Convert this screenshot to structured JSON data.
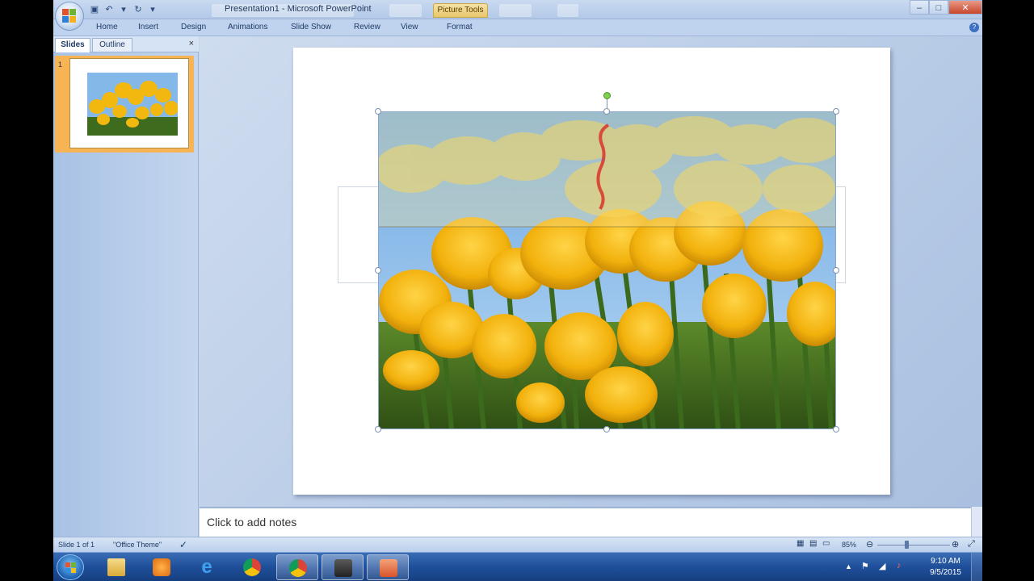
{
  "window": {
    "title": "Presentation1 - Microsoft PowerPoint",
    "contextual_tab_group": "Picture Tools"
  },
  "ribbon": {
    "tabs": [
      "Home",
      "Insert",
      "Design",
      "Animations",
      "Slide Show",
      "Review",
      "View",
      "Format"
    ]
  },
  "left_pane": {
    "tab_slides": "Slides",
    "tab_outline": "Outline",
    "close": "×",
    "slide_number": "1"
  },
  "notes": {
    "placeholder": "Click to add notes"
  },
  "status_bar": {
    "slide_info": "Slide 1 of 1",
    "theme": "\"Office Theme\"",
    "zoom": "85%"
  },
  "taskbar": {
    "time": "9:10 AM",
    "date": "9/5/2015"
  },
  "colors": {
    "tulip": "#f3b80f",
    "sky": "#7fb3e6",
    "stems": "#3f6b1f",
    "red_stroke": "#d9322a"
  }
}
